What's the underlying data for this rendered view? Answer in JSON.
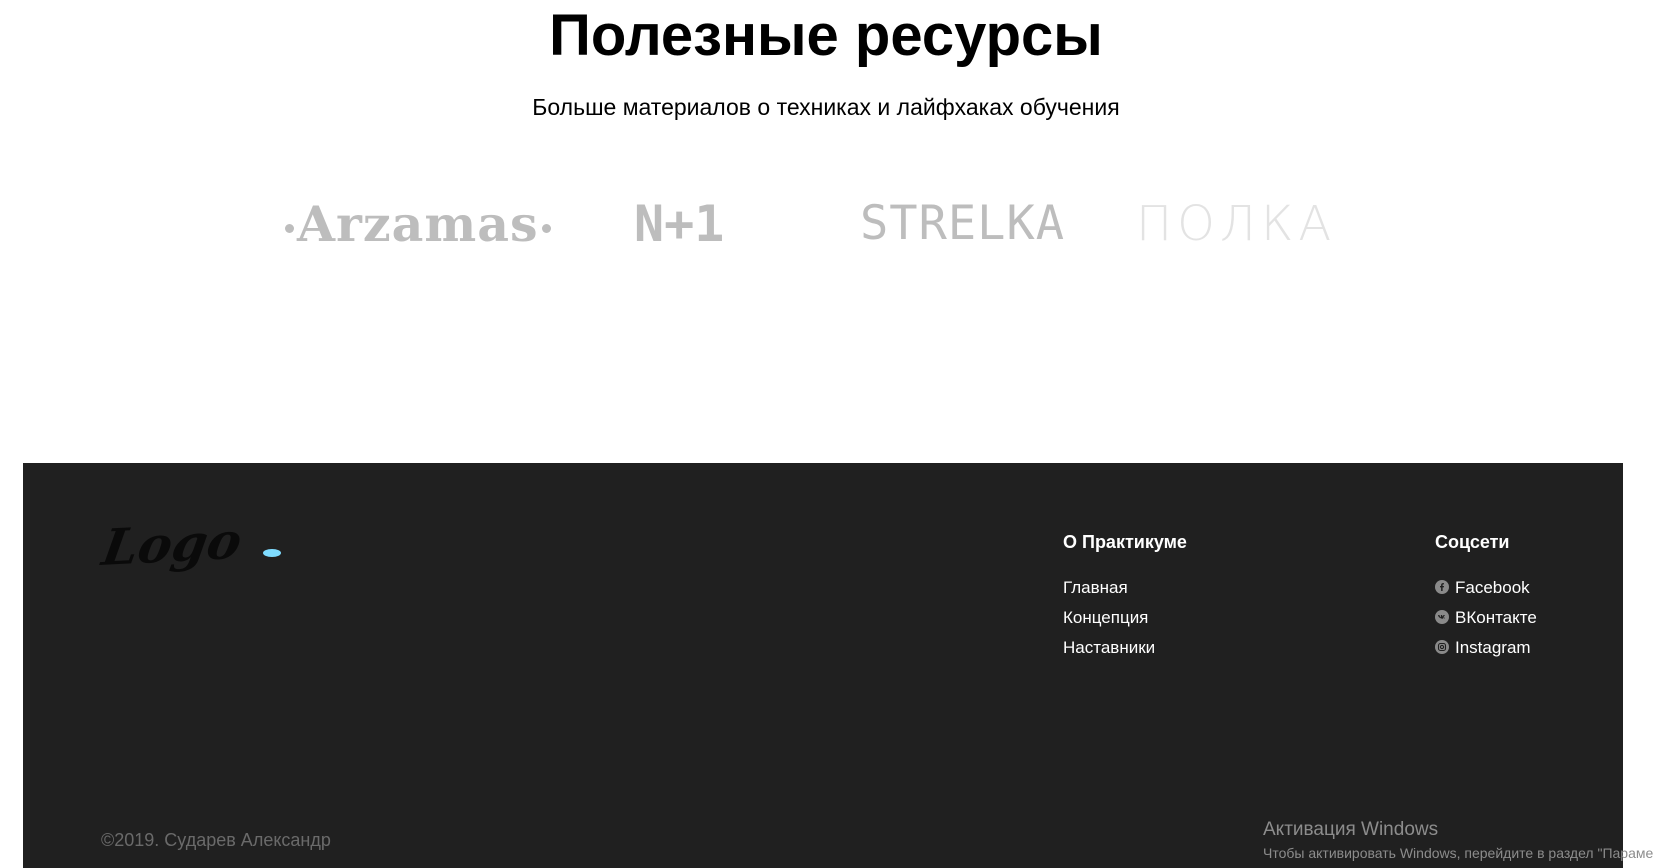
{
  "resources": {
    "title": "Полезные ресурсы",
    "subtitle": "Больше материалов о техниках и лайфхаках обучения",
    "logos": {
      "arzamas": "Arzamas",
      "n1": "N+1",
      "strelka": "STRELKA",
      "polka": "ПОЛКА"
    }
  },
  "footer": {
    "logo_text": "Logo",
    "about": {
      "title": "О Практикуме",
      "links": [
        "Главная",
        "Концепция",
        "Наставники"
      ]
    },
    "social": {
      "title": "Соцсети",
      "links": [
        {
          "label": "Facebook",
          "icon": "facebook-icon"
        },
        {
          "label": "ВКонтакте",
          "icon": "vk-icon"
        },
        {
          "label": "Instagram",
          "icon": "instagram-icon"
        }
      ]
    },
    "copyright": "©2019. Сударев Александр"
  },
  "watermark": {
    "title": "Активация Windows",
    "subtitle": "Чтобы активировать Windows, перейдите в раздел \"Параме"
  },
  "colors": {
    "footer_bg": "#202020",
    "logo_gray": "#bdbdbd",
    "logo_accent": "#7fdcff"
  }
}
